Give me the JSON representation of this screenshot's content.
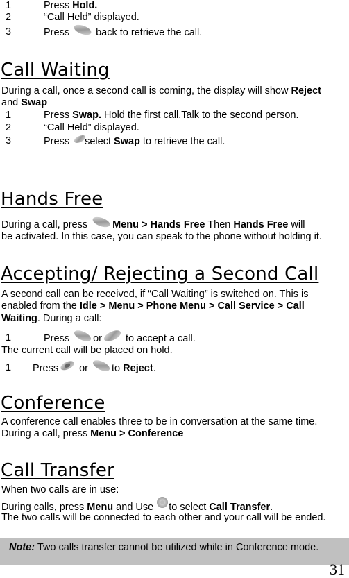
{
  "page": {
    "page_number": "31",
    "top_steps": [
      {
        "num": "1",
        "pre": "Press ",
        "bold": "Hold.",
        "post": ""
      },
      {
        "num": "2",
        "text": "“Call Held” displayed."
      },
      {
        "num": "3",
        "pre": "Press ",
        "icon": "softkey-icon",
        "post": " back to retrieve the call."
      }
    ],
    "sections": {
      "call_waiting": {
        "title": "Call Waiting",
        "intro_1a": "During a call, once a second call is coming, the display will show ",
        "intro_1b": "Reject",
        "intro_2a": "and ",
        "intro_2b": "Swap",
        "steps": [
          {
            "num": "1",
            "pre": "Press ",
            "bold": "Swap.",
            "post": " Hold the first call.Talk to the second person."
          },
          {
            "num": "2",
            "text": "“Call Held” displayed."
          },
          {
            "num": "3",
            "pre": "Press ",
            "icon": "softkey-icon",
            "mid": "select ",
            "bold": "Swap",
            "post": " to retrieve the call."
          }
        ]
      },
      "hands_free": {
        "title": "Hands Free",
        "line1_a": "During a call, press ",
        "line1_b": "Menu > Hands Free",
        "line1_c": " Then ",
        "line1_d": "Hands Free",
        "line1_e": " will",
        "line2": "be activated.  In this case, you can speak to the phone without holding it."
      },
      "accept_reject": {
        "title": "Accepting/ Rejecting a Second Call",
        "line1": "A second call can be received, if “Call Waiting” is switched on. This is",
        "line2_a": "enabled from the ",
        "line2_b": "Idle > Menu > Phone Menu > Call Service > Call",
        "line3_a": "Waiting",
        "line3_b": ".  During a call:",
        "step_accept": {
          "num": "1",
          "pre": "Press ",
          "or": "or",
          "post": " to accept a call."
        },
        "hold_line": "The current call will be placed on hold.",
        "step_reject": {
          "num": "1",
          "pre": "Press",
          "or": " or ",
          "mid": "to ",
          "bold": "Reject",
          "post": "."
        }
      },
      "conference": {
        "title": "Conference",
        "line1": "A conference call enables three to be in conversation at the same time.",
        "line2_a": "During a call, press ",
        "line2_b": "Menu > Conference"
      },
      "call_transfer": {
        "title": "Call Transfer",
        "line1": "When two calls are in use:",
        "line2_a": "During calls, press ",
        "line2_b": "Menu",
        "line2_c": " and Use ",
        "line2_d": "to select ",
        "line2_e": "Call Transfer",
        "line2_f": ".",
        "line3": "The two calls will be connected to each other and your call will be ended."
      }
    },
    "note": {
      "label": "Note:",
      "text": " Two calls transfer cannot be utilized while in Conference mode."
    }
  }
}
